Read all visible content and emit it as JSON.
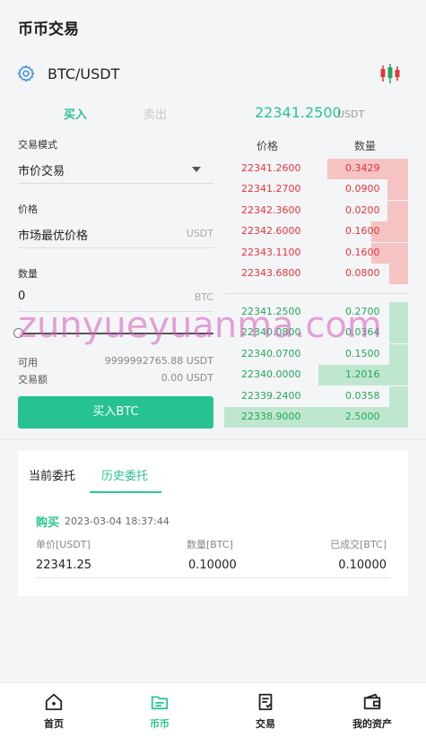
{
  "header": {
    "title": "币币交易"
  },
  "pair": {
    "name": "BTC/USDT"
  },
  "trade_tabs": {
    "buy": "买入",
    "sell": "卖出"
  },
  "last_price": {
    "value": "22341.2500",
    "unit": "USDT"
  },
  "form": {
    "mode_label": "交易模式",
    "mode_value": "市价交易",
    "price_label": "价格",
    "price_value": "市场最优价格",
    "price_unit": "USDT",
    "qty_label": "数量",
    "qty_value": "0",
    "qty_unit": "BTC",
    "slider_percent": 0,
    "available_label": "可用",
    "available_value": "9999992765.88 USDT",
    "amount_label": "交易额",
    "amount_value": "0.00 USDT",
    "submit_label": "买入BTC"
  },
  "orderbook": {
    "price_header": "价格",
    "qty_header": "数量",
    "asks": [
      {
        "price": "22341.2600",
        "qty": "0.3429",
        "depth": 0.44
      },
      {
        "price": "22341.2700",
        "qty": "0.0900",
        "depth": 0.11
      },
      {
        "price": "22342.3600",
        "qty": "0.0200",
        "depth": 0.11
      },
      {
        "price": "22342.6000",
        "qty": "0.1600",
        "depth": 0.2
      },
      {
        "price": "22343.1100",
        "qty": "0.1600",
        "depth": 0.2
      },
      {
        "price": "22343.6800",
        "qty": "0.0800",
        "depth": 0.1
      }
    ],
    "bids": [
      {
        "price": "22341.2500",
        "qty": "0.2700",
        "depth": 0.1
      },
      {
        "price": "22340.0800",
        "qty": "0.0364",
        "depth": 0.1
      },
      {
        "price": "22340.0700",
        "qty": "0.1500",
        "depth": 0.1
      },
      {
        "price": "22340.0000",
        "qty": "1.2016",
        "depth": 0.49
      },
      {
        "price": "22339.2400",
        "qty": "0.0358",
        "depth": 0.1
      },
      {
        "price": "22338.9000",
        "qty": "2.5000",
        "depth": 1.0
      }
    ]
  },
  "watermark": "zunyueyuanma.com",
  "orders": {
    "tab_current": "当前委托",
    "tab_history": "历史委托",
    "item": {
      "type": "购买",
      "time": "2023-03-04 18:37:44",
      "price_header": "单价[USDT]",
      "qty_header": "数量[BTC]",
      "filled_header": "已成交[BTC]",
      "price": "22341.25",
      "qty": "0.10000",
      "filled": "0.10000"
    }
  },
  "nav": [
    {
      "label": "首页",
      "icon": "home-icon"
    },
    {
      "label": "币币",
      "icon": "wallet-icon"
    },
    {
      "label": "交易",
      "icon": "document-icon"
    },
    {
      "label": "我的资产",
      "icon": "purse-icon"
    }
  ],
  "colors": {
    "green": "#2bc48d",
    "red": "#e3353b",
    "button": "#26c291"
  }
}
